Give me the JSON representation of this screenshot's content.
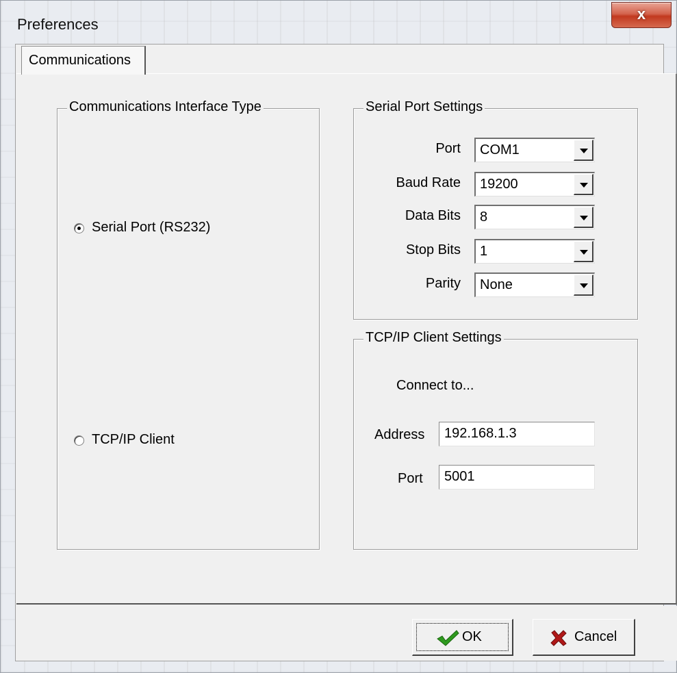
{
  "window": {
    "title": "Preferences",
    "close_label": "x"
  },
  "tabs": [
    {
      "label": "Communications",
      "selected": true
    }
  ],
  "interface_group": {
    "legend": "Communications Interface Type",
    "options": [
      {
        "label": "Serial Port (RS232)",
        "checked": true
      },
      {
        "label": "TCP/IP Client",
        "checked": false
      }
    ]
  },
  "serial_group": {
    "legend": "Serial Port Settings",
    "fields": [
      {
        "label": "Port",
        "value": "COM1"
      },
      {
        "label": "Baud Rate",
        "value": "19200"
      },
      {
        "label": "Data Bits",
        "value": "8"
      },
      {
        "label": "Stop Bits",
        "value": "1"
      },
      {
        "label": "Parity",
        "value": "None"
      }
    ]
  },
  "tcp_group": {
    "legend": "TCP/IP Client Settings",
    "connect_text": "Connect to...",
    "address_label": "Address",
    "address_value": "192.168.1.3",
    "port_label": "Port",
    "port_value": "5001"
  },
  "buttons": {
    "ok_label": "OK",
    "cancel_label": "Cancel"
  },
  "colors": {
    "ok_check": "#2e9a1e",
    "cancel_x": "#b01818",
    "close_button": "#c8452a"
  },
  "icons": {
    "close": "close-icon",
    "ok": "checkmark-icon",
    "cancel": "x-mark-icon"
  }
}
